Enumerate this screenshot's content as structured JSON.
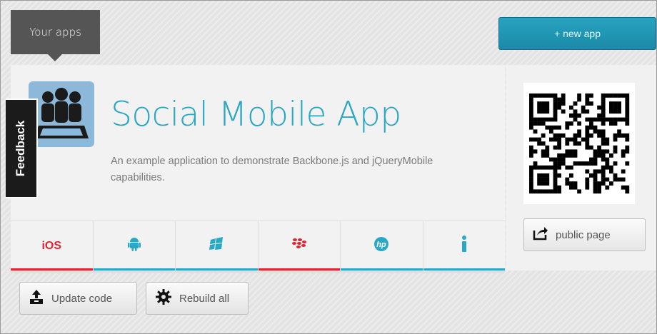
{
  "header": {
    "your_apps_label": "Your apps",
    "new_app_label": "+ new app"
  },
  "app": {
    "title": "Social Mobile App",
    "description": "An example application to demonstrate Backbone.js and jQueryMobile capabilities."
  },
  "feedback": {
    "label": "Feedback"
  },
  "platforms": [
    {
      "name": "iOS",
      "label": "iOS",
      "icon": "ios",
      "bar_color": "#e02433"
    },
    {
      "name": "Android",
      "label": "",
      "icon": "android-icon",
      "bar_color": "#2aa7c5"
    },
    {
      "name": "Windows Phone",
      "label": "",
      "icon": "windows-icon",
      "bar_color": "#2aa7c5"
    },
    {
      "name": "BlackBerry",
      "label": "",
      "icon": "blackberry-icon",
      "bar_color": "#e02433"
    },
    {
      "name": "webOS",
      "label": "",
      "icon": "hp-icon",
      "bar_color": "#2aa7c5"
    },
    {
      "name": "Info",
      "label": "",
      "icon": "info-icon",
      "bar_color": "#2aa7c5"
    }
  ],
  "side": {
    "public_page_label": "public page"
  },
  "actions": {
    "update_code_label": "Update code",
    "rebuild_all_label": "Rebuild all"
  },
  "colors": {
    "accent": "#2aa7c5",
    "alert": "#e02433",
    "tab_dark": "#555555"
  }
}
